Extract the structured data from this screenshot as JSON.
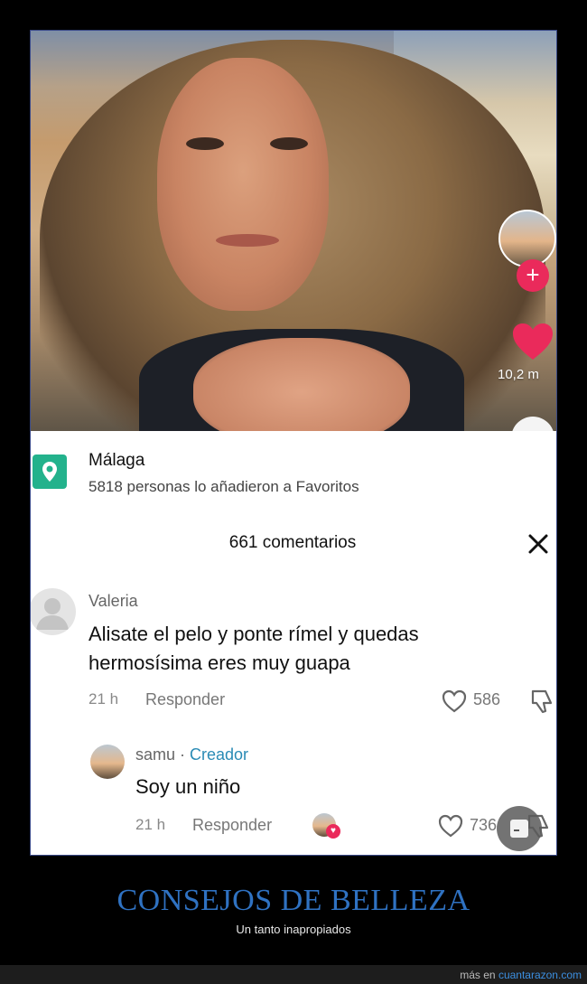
{
  "video": {
    "like_count": "10,2 m",
    "follow_symbol": "+"
  },
  "location": {
    "name": "Málaga",
    "subtitle": "5818 personas lo añadieron a Favoritos"
  },
  "comments": {
    "count_label": "661 comentarios",
    "items": [
      {
        "author": "Valeria",
        "text": "Alisate el pelo y ponte rímel y quedas hermosísima eres muy guapa",
        "time": "21 h",
        "reply_label": "Responder",
        "likes": "586"
      },
      {
        "author": "samu",
        "separator": " · ",
        "badge": "Creador",
        "text": "Soy un niño",
        "time": "21 h",
        "reply_label": "Responder",
        "likes": "736"
      }
    ]
  },
  "caption": {
    "title": "CONSEJOS DE BELLEZA",
    "subtitle": "Un tanto inapropiados"
  },
  "footer": {
    "prefix": "más en ",
    "link": "cuantarazon.com"
  },
  "colors": {
    "accent_pink": "#ea2a5b",
    "creator_blue": "#2a8bb5",
    "title_blue": "#2f72c2",
    "location_green": "#23b28c"
  }
}
